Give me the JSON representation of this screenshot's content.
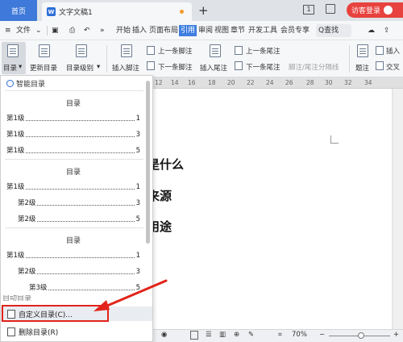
{
  "titlebar": {
    "home_tab": "首页",
    "doc_tab": "文字文稿1",
    "doc_icon": "W",
    "new_tab": "+",
    "page_indicator": "1",
    "guest_login": "访客登录"
  },
  "menubar": {
    "file": "文件",
    "more": "»",
    "items": [
      "开始",
      "插入",
      "页面布局",
      "引用",
      "审阅",
      "视图",
      "章节",
      "开发工具",
      "会员专享"
    ],
    "active_item": "引用",
    "search": "Q查找"
  },
  "ribbon": {
    "toc": "目录",
    "update_toc": "更新目录",
    "toc_level": "目录级别",
    "insert_footnote": "插入脚注",
    "prev_footnote": "上一条脚注",
    "next_footnote": "下一条脚注",
    "insert_endnote": "插入尾注",
    "prev_endnote": "上一条尾注",
    "next_endnote": "下一条尾注",
    "separator": "脚注/尾注分隔线",
    "caption": "题注",
    "insert_short": "插入",
    "cross_short": "交叉"
  },
  "ruler": {
    "ticks": [
      "12",
      "14",
      "16",
      "18",
      "20",
      "22",
      "24",
      "26",
      "28",
      "30",
      "32",
      "34"
    ]
  },
  "document": {
    "headings": [
      "是什么",
      "来源",
      "用途"
    ]
  },
  "toc_panel": {
    "header": "智能目录",
    "groups": [
      {
        "title": "目录",
        "entries": [
          {
            "label": "第1级",
            "page": "1"
          },
          {
            "label": "第1级",
            "page": "3"
          },
          {
            "label": "第1级",
            "page": "5"
          }
        ]
      },
      {
        "title": "目录",
        "entries": [
          {
            "label": "第1级",
            "page": "1"
          },
          {
            "label": "第2级",
            "page": "3"
          },
          {
            "label": "第2级",
            "page": "5"
          }
        ]
      },
      {
        "title": "目录",
        "entries": [
          {
            "label": "第1级",
            "page": "1"
          },
          {
            "label": "第2级",
            "page": "3"
          },
          {
            "label": "第3级",
            "page": "5"
          }
        ]
      }
    ],
    "partial_item": "自动目录",
    "custom_toc": "自定义目录(C)...",
    "delete_toc": "删除目录(R)"
  },
  "statusbar": {
    "zoom": "70%",
    "zoom_out": "−",
    "zoom_in": "+"
  },
  "colors": {
    "accent_blue": "#3f79d9",
    "guest_red": "#e8423f",
    "annotation_red": "#e2231a"
  }
}
